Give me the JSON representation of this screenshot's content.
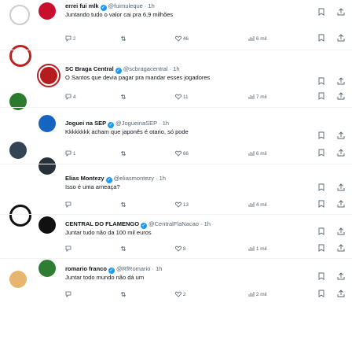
{
  "tweets": [
    {
      "name": "errei fui mlk",
      "handle": "@fuimuleque",
      "time": "1h",
      "text": "Juntando tudo o valor cai pra 6,9 milhões",
      "replies": "2",
      "retweets": "",
      "likes": "46",
      "views": "6 mil"
    },
    {
      "name": "SC Braga Central",
      "handle": "@scbragacentral",
      "time": "1h",
      "text": "O Santos que devia pagar pra mandar esses jogadores",
      "replies": "4",
      "retweets": "",
      "likes": "11",
      "views": "7 mil"
    },
    {
      "name": "Joguei na SEP",
      "handle": "@JogueinaSEP",
      "time": "1h",
      "text": "Kkkkkkkk acham que japonês é otario, só pode",
      "replies": "1",
      "retweets": "",
      "likes": "66",
      "views": "6 mil"
    },
    {
      "name": "Elias Montezy",
      "handle": "@eliasmontezy",
      "time": "1h",
      "text": "Isso é uma ameaça?",
      "replies": "",
      "retweets": "",
      "likes": "13",
      "views": "4 mil"
    },
    {
      "name": "CENTRAL DO FLAMENGO",
      "handle": "@CentralFlaNacao",
      "time": "1h",
      "text": "Juntar tudo não da 100 mil euros",
      "replies": "",
      "retweets": "",
      "likes": "8",
      "views": "1 mil"
    },
    {
      "name": "romario franco",
      "handle": "@RfRomario",
      "time": "1h",
      "text": "Juntar todo mundo não dá um",
      "replies": "",
      "retweets": "",
      "likes": "2",
      "views": "2 mil"
    }
  ],
  "side_icons": [
    "message-icon",
    "settings-icon",
    "gear-icon",
    "people-icon",
    "star-icon",
    "grid-icon"
  ],
  "colors": {
    "accent": "#1d9bf0",
    "text": "#0f1419",
    "muted": "#536471",
    "divider": "#eff3f4"
  }
}
